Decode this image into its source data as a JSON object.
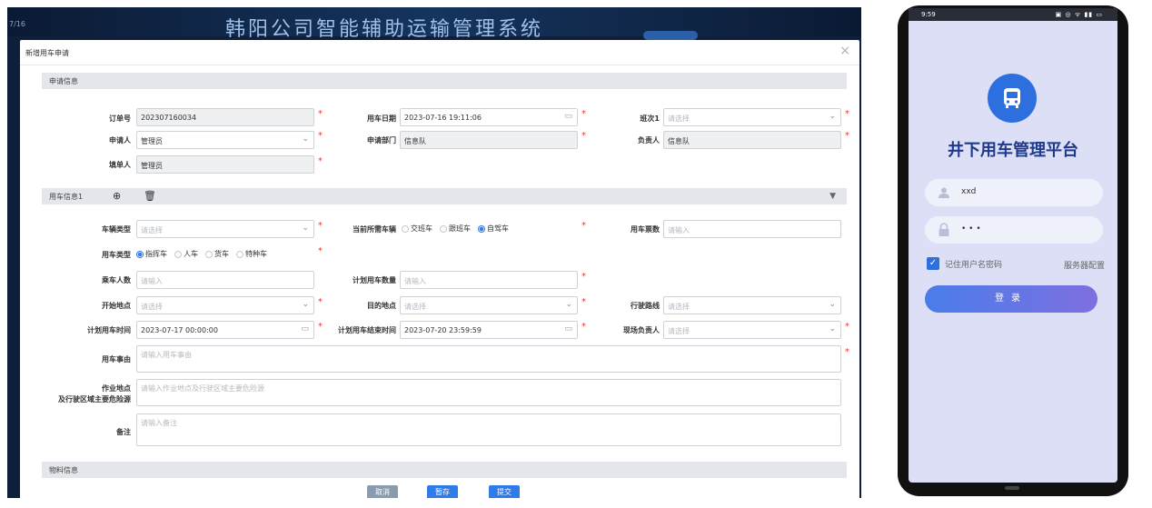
{
  "desktop": {
    "banner_title": "韩阳公司智能辅助运输管理系统",
    "corner_text": "7/16",
    "modal": {
      "title": "新增用车申请",
      "close_glyph": "×",
      "sections": {
        "apply_info": "申请信息",
        "car_info": "用车信息1",
        "material_info": "物料信息"
      },
      "fields": {
        "order_no": {
          "label": "订单号",
          "value": "202307160034"
        },
        "use_date": {
          "label": "用车日期",
          "value": "2023-07-16 19:11:06"
        },
        "shift": {
          "label": "班次1",
          "placeholder": "请选择"
        },
        "applicant": {
          "label": "申请人",
          "value": "管理员"
        },
        "apply_dept": {
          "label": "申请部门",
          "value": "信息队"
        },
        "responsible": {
          "label": "负责人",
          "value": "信息队"
        },
        "filler": {
          "label": "填单人",
          "value": "管理员"
        },
        "vehicle_type": {
          "label": "车辆类型",
          "placeholder": "请选择"
        },
        "current_vehicle": {
          "label": "当前所需车辆",
          "options": [
            "交班车",
            "跟班车",
            "自驾车"
          ],
          "selected": 2
        },
        "ticket_count": {
          "label": "用车票数",
          "placeholder": "请输入"
        },
        "use_type": {
          "label": "用车类型",
          "options": [
            "指挥车",
            "人车",
            "货车",
            "特种车"
          ],
          "selected": 0
        },
        "passengers": {
          "label": "乘车人数",
          "placeholder": "请输入"
        },
        "plan_count": {
          "label": "计划用车数量",
          "placeholder": "请输入"
        },
        "start_place": {
          "label": "开始地点",
          "placeholder": "请选择"
        },
        "destination": {
          "label": "目的地点",
          "placeholder": "请选择"
        },
        "route": {
          "label": "行驶路线",
          "placeholder": "请选择"
        },
        "plan_start": {
          "label": "计划用车时间",
          "value": "2023-07-17 00:00:00"
        },
        "plan_end": {
          "label": "计划用车结束时间",
          "value": "2023-07-20 23:59:59"
        },
        "site_owner": {
          "label": "现场负责人",
          "placeholder": "请选择"
        },
        "reason": {
          "label": "用车事由",
          "placeholder": "请输入用车事由"
        },
        "work_site": {
          "label_line1": "作业地点",
          "label_line2": "及行驶区域主要危险源",
          "placeholder": "请输入作业地点及行驶区域主要危险源"
        },
        "remark": {
          "label": "备注",
          "placeholder": "请输入备注"
        }
      },
      "buttons": {
        "cancel": "取消",
        "save_draft": "暂存",
        "submit": "提交"
      }
    }
  },
  "phone": {
    "status_time": "9:59",
    "status_icons": "▣ ◎ ᯤ ▮▮ ▭",
    "app_title": "井下用车管理平台",
    "username": "xxd",
    "password_mask": "• • •",
    "remember_label": "记住用户名密码",
    "server_config": "服务器配置",
    "login_label": "登录"
  },
  "colors": {
    "primary": "#2e6fe0",
    "required": "#e53935",
    "cancel_btn": "#8a9bb0",
    "save_btn": "#2f7be8",
    "submit_btn": "#2f7be8"
  }
}
